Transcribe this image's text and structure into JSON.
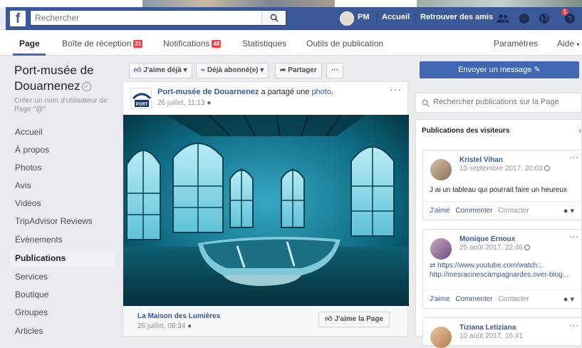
{
  "topbar": {
    "logo": "f",
    "search_placeholder": "Rechercher",
    "user_initials": "PM",
    "home_label": "Accueil",
    "find_friends_label": "Retrouver des amis",
    "notif_count": "1",
    "brand_color": "#3b5998"
  },
  "pagebar": {
    "tabs": [
      {
        "label": "Page"
      },
      {
        "label": "Boîte de réception",
        "badge": "21"
      },
      {
        "label": "Notifications",
        "badge": "48"
      },
      {
        "label": "Statistiques"
      },
      {
        "label": "Outils de publication"
      }
    ],
    "settings_label": "Paramètres",
    "help_label": "Aide"
  },
  "sidebar": {
    "page_name_line1": "Port-musée de",
    "page_name_line2": "Douarnenez",
    "username_hint": "Créer un nom d'utilisateur de Page \"@\"",
    "items": [
      {
        "label": "Accueil"
      },
      {
        "label": "À propos"
      },
      {
        "label": "Photos"
      },
      {
        "label": "Avis"
      },
      {
        "label": "Vidéos"
      },
      {
        "label": "TripAdvisor Reviews"
      },
      {
        "label": "Évènements"
      },
      {
        "label": "Publications"
      },
      {
        "label": "Services"
      },
      {
        "label": "Boutique"
      },
      {
        "label": "Groupes"
      },
      {
        "label": "Articles"
      }
    ]
  },
  "actions": {
    "like_label": "J'aime déjà",
    "follow_label": "Déjà abonné(e)",
    "share_label": "Partager",
    "more_label": "···"
  },
  "post": {
    "author": "Port-musée de Douarnenez",
    "action_text": " a partagé une ",
    "object_text": "photo",
    "object_suffix": ".",
    "date": "26 juillet, 11:13",
    "link_title": "La Maison des Lumières",
    "link_date": "26 juillet, 08:34",
    "like_page_label": "J'aime la Page"
  },
  "right": {
    "send_message_label": "Envoyer un message",
    "search_placeholder": "Rechercher publications sur la Page",
    "visitor_title": "Publications des visiteurs",
    "visitor_posts": [
      {
        "name": "Kristel Vihan",
        "date": "13 septembre 2017, 20:03",
        "text": "J ai un tableau qui pourrait faire un heureux",
        "actions": [
          "J'aime",
          "Commenter",
          "Contacter"
        ]
      },
      {
        "name": "Monique Ernoux",
        "date": "25 août 2017, 22:46",
        "link1": "https://www.youtube.com/watch...",
        "link2": "http://mesracinescampagnardes.over-blog...",
        "actions": [
          "J'aime",
          "Commenter",
          "Contacter"
        ]
      },
      {
        "name": "Tiziana Letiziana",
        "date": "10 août 2017, 16:41"
      }
    ]
  }
}
